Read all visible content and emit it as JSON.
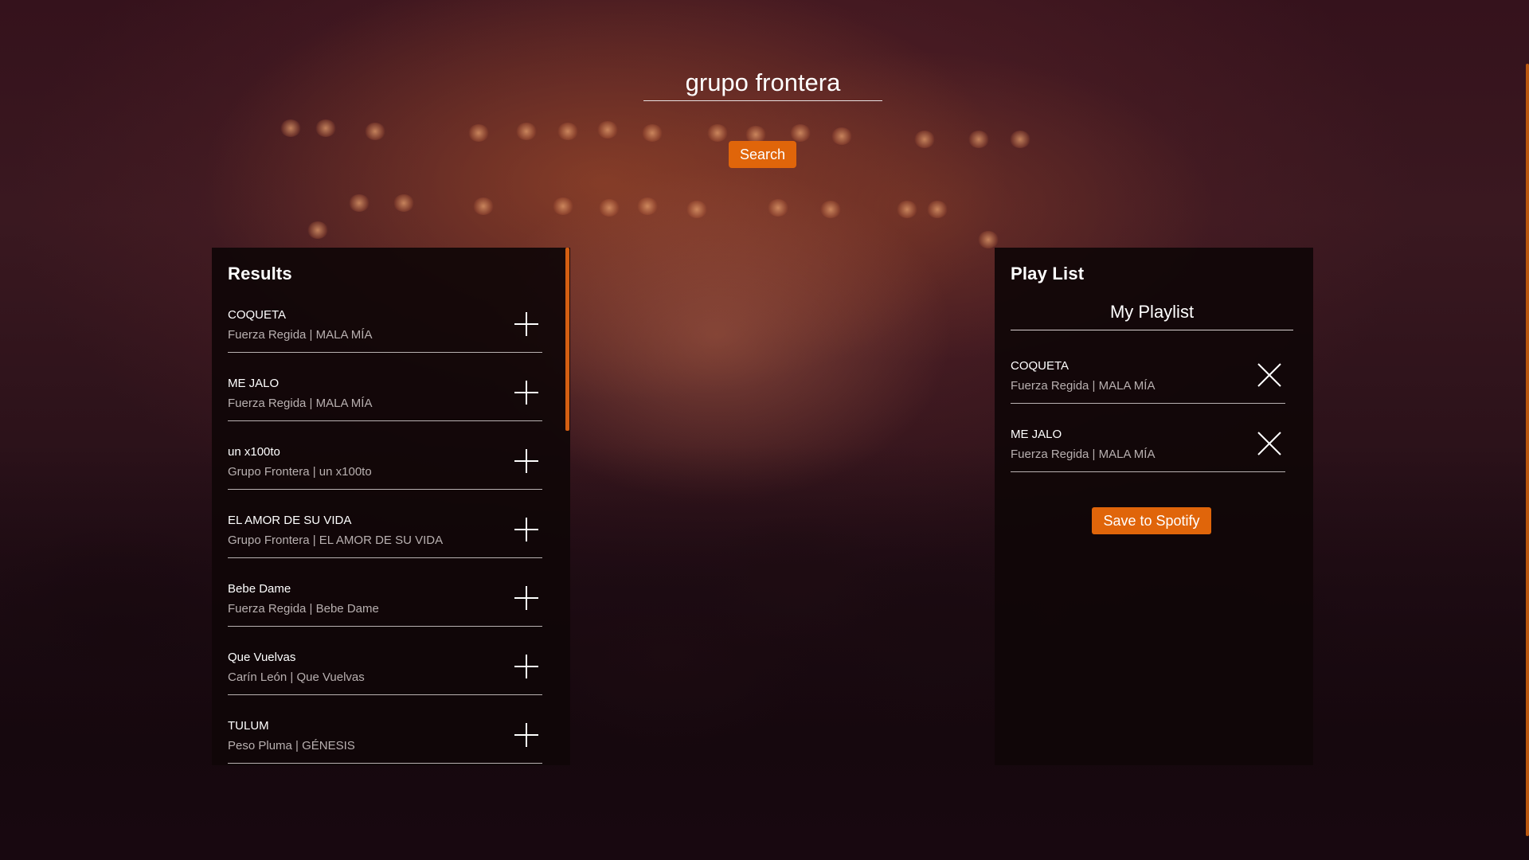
{
  "search": {
    "value": "grupo frontera",
    "button_label": "Search"
  },
  "results": {
    "title": "Results",
    "tracks": [
      {
        "name": "COQUETA",
        "info": "Fuerza Regida | MALA MÍA",
        "action_icon": "plus-icon"
      },
      {
        "name": "ME JALO",
        "info": "Fuerza Regida | MALA MÍA",
        "action_icon": "plus-icon"
      },
      {
        "name": "un x100to",
        "info": "Grupo Frontera | un x100to",
        "action_icon": "plus-icon"
      },
      {
        "name": "EL AMOR DE SU VIDA",
        "info": "Grupo Frontera | EL AMOR DE SU VIDA",
        "action_icon": "plus-icon"
      },
      {
        "name": "Bebe Dame",
        "info": "Fuerza Regida | Bebe Dame",
        "action_icon": "plus-icon"
      },
      {
        "name": "Que Vuelvas",
        "info": "Carín León | Que Vuelvas",
        "action_icon": "plus-icon"
      },
      {
        "name": "TULUM",
        "info": "Peso Pluma | GÉNESIS",
        "action_icon": "plus-icon"
      }
    ]
  },
  "playlist": {
    "title": "Play List",
    "name": "My Playlist",
    "tracks": [
      {
        "name": "COQUETA",
        "info": "Fuerza Regida | MALA MÍA",
        "action_icon": "close-icon"
      },
      {
        "name": "ME JALO",
        "info": "Fuerza Regida | MALA MÍA",
        "action_icon": "close-icon"
      }
    ],
    "save_label": "Save to Spotify"
  },
  "colors": {
    "accent": "#e0650a",
    "panel": "#100608",
    "muted_text": "#b8b0b0"
  }
}
